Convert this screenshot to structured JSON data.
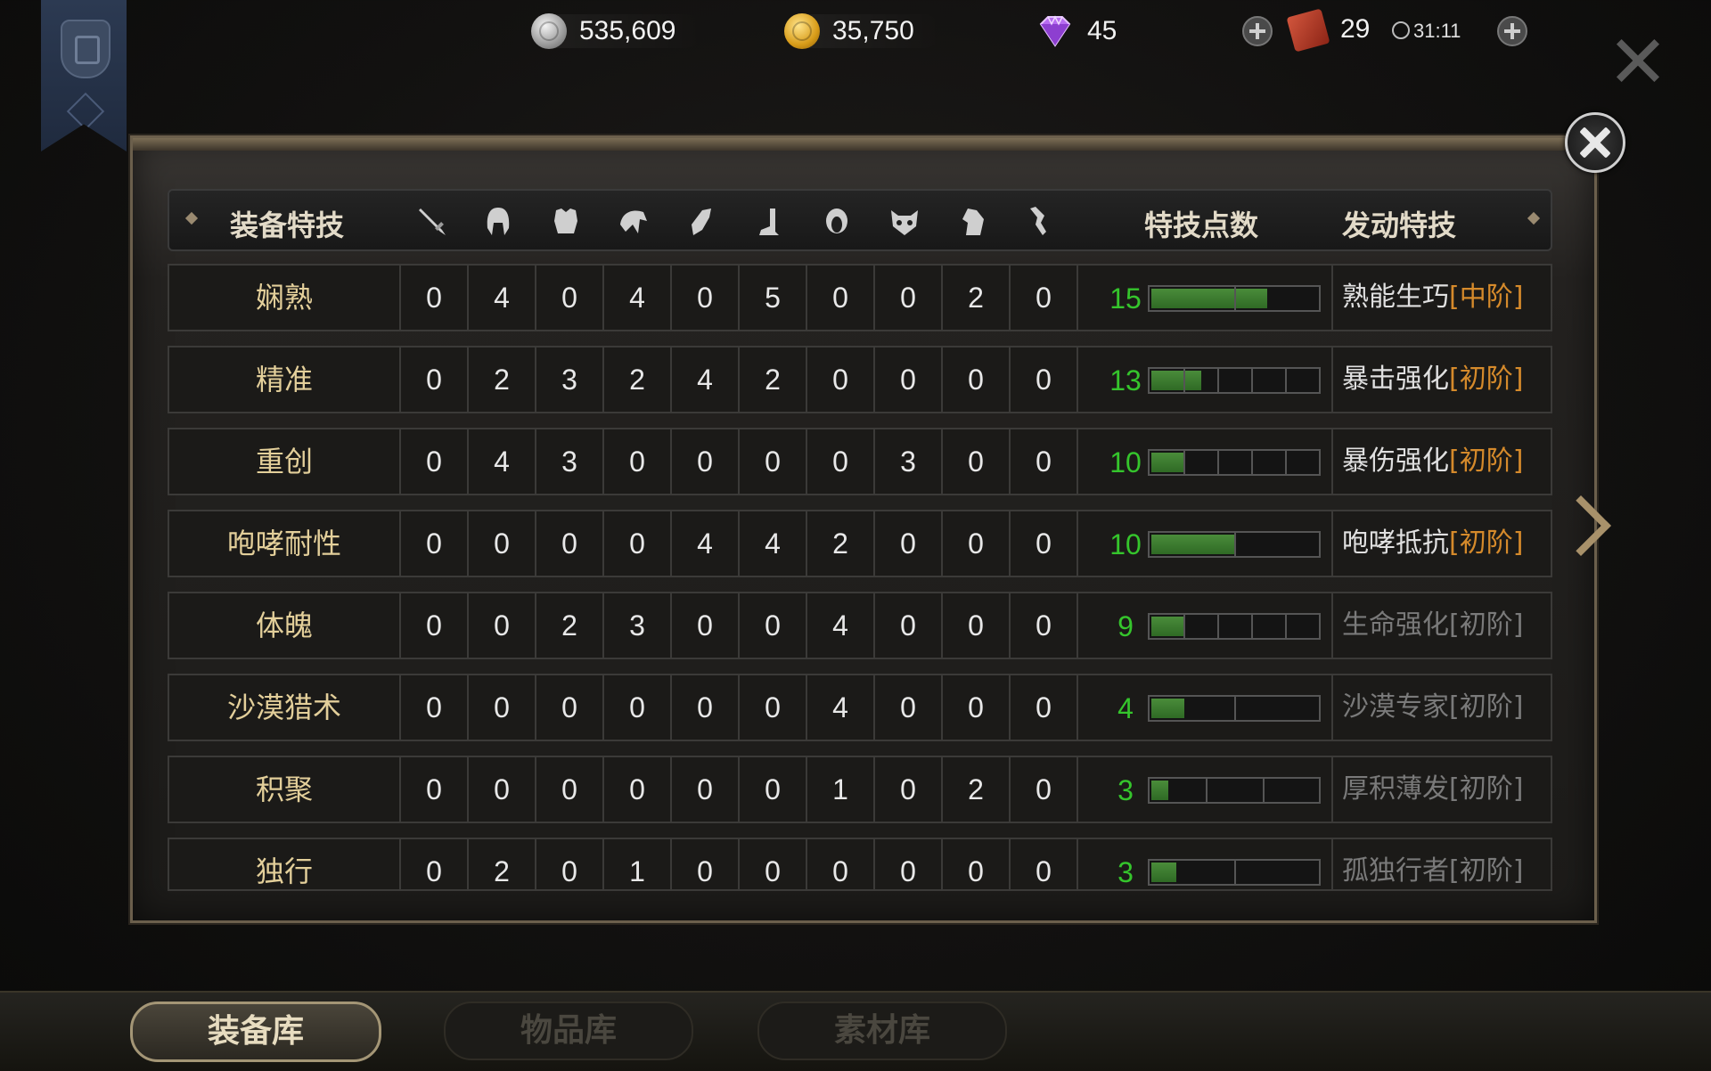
{
  "resources": {
    "silver": "535,609",
    "gold": "35,750",
    "gems": "45",
    "tickets": "29",
    "timer": "31:11"
  },
  "table": {
    "header_left": "装备特技",
    "header_points": "特技点数",
    "header_skill": "发动特技",
    "slot_icons": [
      "sword-icon",
      "helmet-icon",
      "chest-armor-icon",
      "shoulder-icon",
      "glove-icon",
      "boot-icon",
      "ring-icon",
      "beast-mask-icon",
      "horse-icon",
      "accessory-icon"
    ],
    "rows": [
      {
        "name": "娴熟",
        "values": [
          "0",
          "4",
          "0",
          "4",
          "0",
          "5",
          "0",
          "0",
          "2",
          "0"
        ],
        "points": "15",
        "progress": 0.7,
        "segments": 2,
        "skill": "熟能生巧",
        "level": "[中阶]",
        "active": true
      },
      {
        "name": "精准",
        "values": [
          "0",
          "2",
          "3",
          "2",
          "4",
          "2",
          "0",
          "0",
          "0",
          "0"
        ],
        "points": "13",
        "progress": 0.3,
        "segments": 5,
        "skill": "暴击强化",
        "level": "[初阶]",
        "active": true
      },
      {
        "name": "重创",
        "values": [
          "0",
          "4",
          "3",
          "0",
          "0",
          "0",
          "0",
          "3",
          "0",
          "0"
        ],
        "points": "10",
        "progress": 0.2,
        "segments": 5,
        "skill": "暴伤强化",
        "level": "[初阶]",
        "active": true
      },
      {
        "name": "咆哮耐性",
        "values": [
          "0",
          "0",
          "0",
          "0",
          "4",
          "4",
          "2",
          "0",
          "0",
          "0"
        ],
        "points": "10",
        "progress": 0.5,
        "segments": 2,
        "skill": "咆哮抵抗",
        "level": "[初阶]",
        "active": true
      },
      {
        "name": "体魄",
        "values": [
          "0",
          "0",
          "2",
          "3",
          "0",
          "0",
          "4",
          "0",
          "0",
          "0"
        ],
        "points": "9",
        "progress": 0.2,
        "segments": 5,
        "skill": "生命强化",
        "level": "[初阶]",
        "active": false
      },
      {
        "name": "沙漠猎术",
        "values": [
          "0",
          "0",
          "0",
          "0",
          "0",
          "0",
          "4",
          "0",
          "0",
          "0"
        ],
        "points": "4",
        "progress": 0.2,
        "segments": 2,
        "skill": "沙漠专家",
        "level": "[初阶]",
        "active": false
      },
      {
        "name": "积聚",
        "values": [
          "0",
          "0",
          "0",
          "0",
          "0",
          "0",
          "1",
          "0",
          "2",
          "0"
        ],
        "points": "3",
        "progress": 0.1,
        "segments": 3,
        "skill": "厚积薄发",
        "level": "[初阶]",
        "active": false
      },
      {
        "name": "独行",
        "values": [
          "0",
          "2",
          "0",
          "1",
          "0",
          "0",
          "0",
          "0",
          "0",
          "0"
        ],
        "points": "3",
        "progress": 0.15,
        "segments": 2,
        "skill": "孤独行者",
        "level": "[初阶]",
        "active": false
      }
    ]
  },
  "tabs": [
    "装备库",
    "物品库",
    "素材库"
  ],
  "colors": {
    "points": "#35c52c",
    "level": "#d58a2b",
    "name": "#e3cf9a"
  }
}
